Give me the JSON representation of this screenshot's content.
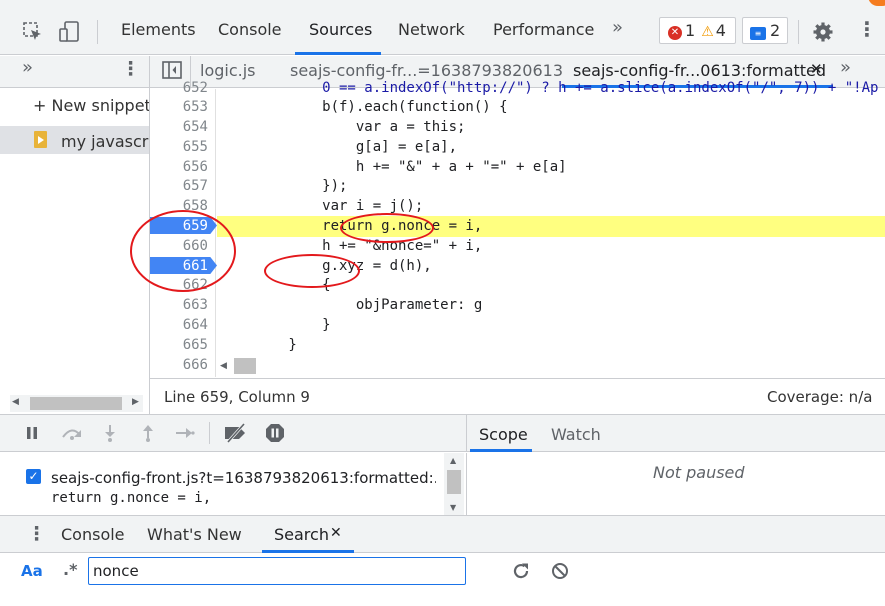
{
  "toolbar": {
    "tabs": [
      "Elements",
      "Console",
      "Sources",
      "Network",
      "Performance"
    ],
    "more": "»",
    "errors": "1",
    "warnings": "4",
    "messages": "2"
  },
  "navigator": {
    "more": "»",
    "new_snippet": "+ New snippet",
    "snippet_name": "my javascrip"
  },
  "editor": {
    "tabs": [
      "logic.js",
      "seajs-config-fr...=1638793820613",
      "seajs-config-fr...0613:formatted"
    ],
    "active_tab_close": "✕",
    "more": "»",
    "lines": [
      {
        "n": "652",
        "text": "            0 == a.indexOf(\"http://\") ? h += a.slice(a.indexOf(\"/\", 7)) + \"!Ap"
      },
      {
        "n": "653",
        "text": "            b(f).each(function() {"
      },
      {
        "n": "654",
        "text": "                var a = this;"
      },
      {
        "n": "655",
        "text": "                g[a] = e[a],"
      },
      {
        "n": "656",
        "text": "                h += \"&\" + a + \"=\" + e[a]"
      },
      {
        "n": "657",
        "text": "            });"
      },
      {
        "n": "658",
        "text": "            var i = j();"
      },
      {
        "n": "659",
        "text": "            return g.nonce = i,"
      },
      {
        "n": "660",
        "text": "            h += \"&nonce=\" + i,"
      },
      {
        "n": "661",
        "text": "            g.xyz = d(h),"
      },
      {
        "n": "662",
        "text": "            {"
      },
      {
        "n": "663",
        "text": "                objParameter: g"
      },
      {
        "n": "664",
        "text": "            }"
      },
      {
        "n": "665",
        "text": "        }"
      },
      {
        "n": "666",
        "text": ""
      }
    ],
    "status_position": "Line 659, Column 9",
    "status_coverage": "Coverage: n/a"
  },
  "debugger": {
    "scope_tab": "Scope",
    "watch_tab": "Watch",
    "not_paused": "Not paused",
    "breakpoint_file": "seajs-config-front.js?t=1638793820613:formatted:...",
    "breakpoint_code": "return g.nonce = i,"
  },
  "drawer": {
    "tabs": [
      "Console",
      "What's New",
      "Search"
    ],
    "search_close": "✕",
    "case_toggle": "Aa",
    "regex_toggle": ".*",
    "search_value": "nonce"
  },
  "colors": {
    "accent": "#1a73e8",
    "breakpoint": "#4285f4",
    "exec_highlight": "#ffff80",
    "annotation": "#e3191c"
  }
}
